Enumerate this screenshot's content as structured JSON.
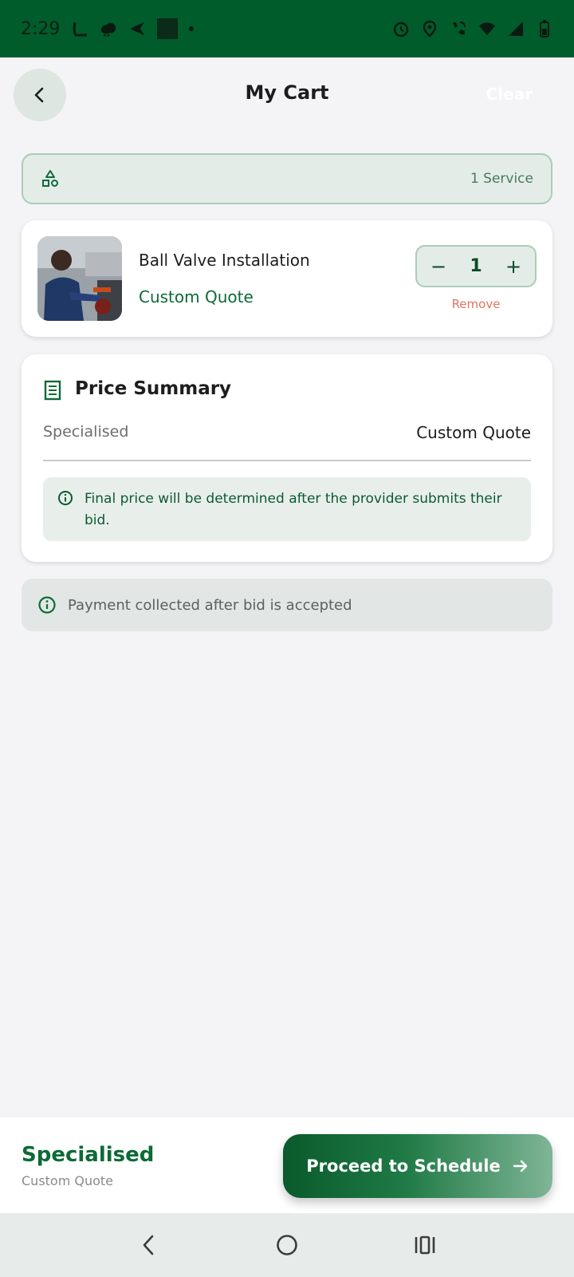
{
  "status_bar": {
    "time": "2:29",
    "icons": [
      "notification-l-icon",
      "cloud-icon",
      "send-icon",
      "square-app-icon",
      "dot-icon",
      "alarm-icon",
      "location-icon",
      "wifi-calling-icon",
      "wifi-icon",
      "signal-icon",
      "battery-icon"
    ]
  },
  "header": {
    "title": "My Cart",
    "clear_label": "Clear",
    "back_icon": "chevron-left-icon"
  },
  "service_bar": {
    "icon": "shapes-icon",
    "count_text": "1 Service"
  },
  "cart_items": [
    {
      "name": "Ball Valve Installation",
      "price": "Custom Quote",
      "quantity": "1",
      "decrement": "−",
      "increment": "+",
      "remove_label": "Remove"
    }
  ],
  "price_summary": {
    "title": "Price Summary",
    "icon": "receipt-icon",
    "label": "Specialised",
    "value": "Custom Quote",
    "notice": "Final price will be determined after the provider submits their bid."
  },
  "payment_note": {
    "text": "Payment collected after bid is accepted"
  },
  "bottom_bar": {
    "title": "Specialised",
    "subtitle": "Custom Quote",
    "proceed_label": "Proceed to Schedule"
  },
  "colors": {
    "status_bar": "#005c2b",
    "brand_green": "#0d6a37",
    "remove": "#e07560",
    "background": "#f4f3f6"
  }
}
